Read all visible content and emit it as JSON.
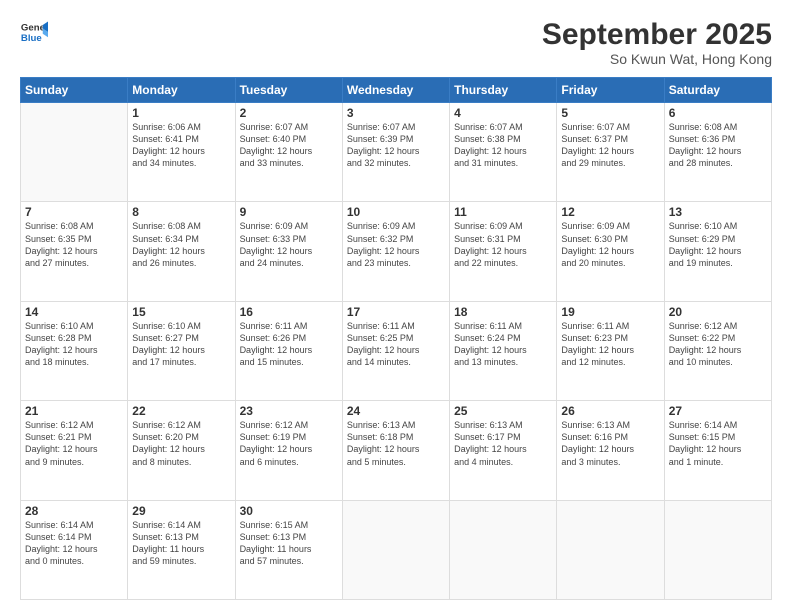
{
  "logo": {
    "line1": "General",
    "line2": "Blue"
  },
  "header": {
    "month": "September 2025",
    "location": "So Kwun Wat, Hong Kong"
  },
  "weekdays": [
    "Sunday",
    "Monday",
    "Tuesday",
    "Wednesday",
    "Thursday",
    "Friday",
    "Saturday"
  ],
  "weeks": [
    [
      {
        "day": "",
        "info": ""
      },
      {
        "day": "1",
        "info": "Sunrise: 6:06 AM\nSunset: 6:41 PM\nDaylight: 12 hours\nand 34 minutes."
      },
      {
        "day": "2",
        "info": "Sunrise: 6:07 AM\nSunset: 6:40 PM\nDaylight: 12 hours\nand 33 minutes."
      },
      {
        "day": "3",
        "info": "Sunrise: 6:07 AM\nSunset: 6:39 PM\nDaylight: 12 hours\nand 32 minutes."
      },
      {
        "day": "4",
        "info": "Sunrise: 6:07 AM\nSunset: 6:38 PM\nDaylight: 12 hours\nand 31 minutes."
      },
      {
        "day": "5",
        "info": "Sunrise: 6:07 AM\nSunset: 6:37 PM\nDaylight: 12 hours\nand 29 minutes."
      },
      {
        "day": "6",
        "info": "Sunrise: 6:08 AM\nSunset: 6:36 PM\nDaylight: 12 hours\nand 28 minutes."
      }
    ],
    [
      {
        "day": "7",
        "info": "Sunrise: 6:08 AM\nSunset: 6:35 PM\nDaylight: 12 hours\nand 27 minutes."
      },
      {
        "day": "8",
        "info": "Sunrise: 6:08 AM\nSunset: 6:34 PM\nDaylight: 12 hours\nand 26 minutes."
      },
      {
        "day": "9",
        "info": "Sunrise: 6:09 AM\nSunset: 6:33 PM\nDaylight: 12 hours\nand 24 minutes."
      },
      {
        "day": "10",
        "info": "Sunrise: 6:09 AM\nSunset: 6:32 PM\nDaylight: 12 hours\nand 23 minutes."
      },
      {
        "day": "11",
        "info": "Sunrise: 6:09 AM\nSunset: 6:31 PM\nDaylight: 12 hours\nand 22 minutes."
      },
      {
        "day": "12",
        "info": "Sunrise: 6:09 AM\nSunset: 6:30 PM\nDaylight: 12 hours\nand 20 minutes."
      },
      {
        "day": "13",
        "info": "Sunrise: 6:10 AM\nSunset: 6:29 PM\nDaylight: 12 hours\nand 19 minutes."
      }
    ],
    [
      {
        "day": "14",
        "info": "Sunrise: 6:10 AM\nSunset: 6:28 PM\nDaylight: 12 hours\nand 18 minutes."
      },
      {
        "day": "15",
        "info": "Sunrise: 6:10 AM\nSunset: 6:27 PM\nDaylight: 12 hours\nand 17 minutes."
      },
      {
        "day": "16",
        "info": "Sunrise: 6:11 AM\nSunset: 6:26 PM\nDaylight: 12 hours\nand 15 minutes."
      },
      {
        "day": "17",
        "info": "Sunrise: 6:11 AM\nSunset: 6:25 PM\nDaylight: 12 hours\nand 14 minutes."
      },
      {
        "day": "18",
        "info": "Sunrise: 6:11 AM\nSunset: 6:24 PM\nDaylight: 12 hours\nand 13 minutes."
      },
      {
        "day": "19",
        "info": "Sunrise: 6:11 AM\nSunset: 6:23 PM\nDaylight: 12 hours\nand 12 minutes."
      },
      {
        "day": "20",
        "info": "Sunrise: 6:12 AM\nSunset: 6:22 PM\nDaylight: 12 hours\nand 10 minutes."
      }
    ],
    [
      {
        "day": "21",
        "info": "Sunrise: 6:12 AM\nSunset: 6:21 PM\nDaylight: 12 hours\nand 9 minutes."
      },
      {
        "day": "22",
        "info": "Sunrise: 6:12 AM\nSunset: 6:20 PM\nDaylight: 12 hours\nand 8 minutes."
      },
      {
        "day": "23",
        "info": "Sunrise: 6:12 AM\nSunset: 6:19 PM\nDaylight: 12 hours\nand 6 minutes."
      },
      {
        "day": "24",
        "info": "Sunrise: 6:13 AM\nSunset: 6:18 PM\nDaylight: 12 hours\nand 5 minutes."
      },
      {
        "day": "25",
        "info": "Sunrise: 6:13 AM\nSunset: 6:17 PM\nDaylight: 12 hours\nand 4 minutes."
      },
      {
        "day": "26",
        "info": "Sunrise: 6:13 AM\nSunset: 6:16 PM\nDaylight: 12 hours\nand 3 minutes."
      },
      {
        "day": "27",
        "info": "Sunrise: 6:14 AM\nSunset: 6:15 PM\nDaylight: 12 hours\nand 1 minute."
      }
    ],
    [
      {
        "day": "28",
        "info": "Sunrise: 6:14 AM\nSunset: 6:14 PM\nDaylight: 12 hours\nand 0 minutes."
      },
      {
        "day": "29",
        "info": "Sunrise: 6:14 AM\nSunset: 6:13 PM\nDaylight: 11 hours\nand 59 minutes."
      },
      {
        "day": "30",
        "info": "Sunrise: 6:15 AM\nSunset: 6:13 PM\nDaylight: 11 hours\nand 57 minutes."
      },
      {
        "day": "",
        "info": ""
      },
      {
        "day": "",
        "info": ""
      },
      {
        "day": "",
        "info": ""
      },
      {
        "day": "",
        "info": ""
      }
    ]
  ]
}
